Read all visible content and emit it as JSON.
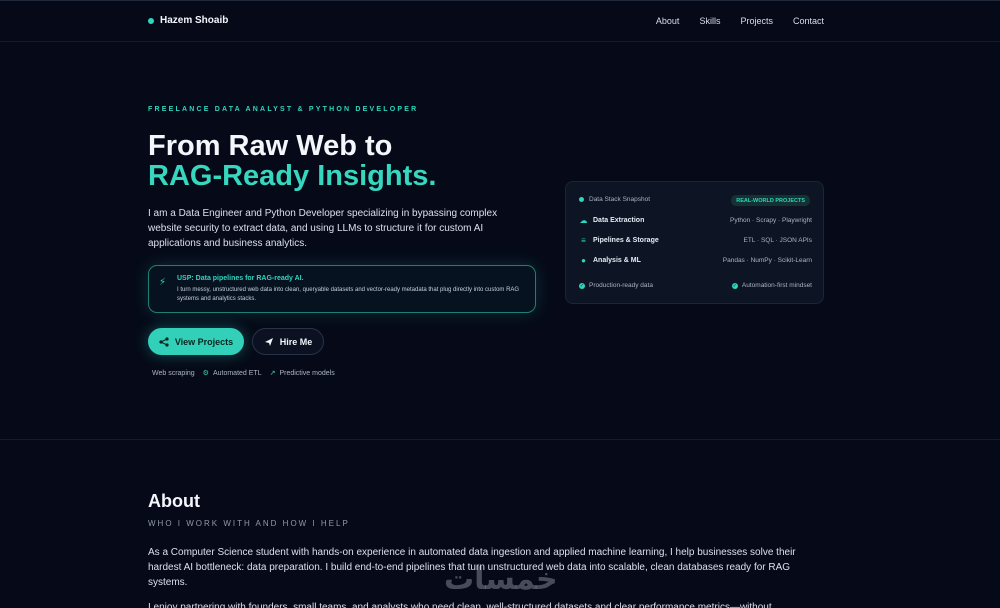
{
  "nav": {
    "brand": "Hazem Shoaib",
    "links": [
      "About",
      "Skills",
      "Projects",
      "Contact"
    ]
  },
  "hero": {
    "eyebrow": "FREELANCE DATA ANALYST & PYTHON DEVELOPER",
    "title_line1": "From Raw Web to",
    "title_line2": "RAG-Ready Insights.",
    "lead": "I am a Data Engineer and Python Developer specializing in bypassing complex website security to extract data, and using LLMs to structure it for custom AI applications and business analytics.",
    "usp_title": "USP: Data pipelines for RAG-ready AI.",
    "usp_text": "I turn messy, unstructured web data into clean, queryable datasets and vector-ready metadata that plug directly into custom RAG systems and analytics stacks.",
    "primary_button": "View Projects",
    "secondary_button": "Hire Me",
    "tags": [
      "Web scraping",
      "Automated ETL",
      "Predictive models"
    ]
  },
  "card": {
    "title": "Data Stack Snapshot",
    "badge": "REAL-WORLD PROJECTS",
    "rows": [
      {
        "label": "Data Extraction",
        "value": "Python · Scrapy · Playwright",
        "icon": "cloud-icon"
      },
      {
        "label": "Pipelines & Storage",
        "value": "ETL · SQL · JSON APIs",
        "icon": "database-icon"
      },
      {
        "label": "Analysis & ML",
        "value": "Pandas · NumPy · Scikit-Learn",
        "icon": "brain-icon"
      }
    ],
    "footer_left": "Production-ready data",
    "footer_right": "Automation-first mindset"
  },
  "about": {
    "title": "About",
    "subtitle": "WHO I WORK WITH AND HOW I HELP",
    "p1": "As a Computer Science student with hands-on experience in automated data ingestion and applied machine learning, I help businesses solve their hardest AI bottleneck: data preparation. I build end-to-end pipelines that turn unstructured web data into scalable, clean databases ready for RAG systems.",
    "p2": "I enjoy partnering with founders, small teams, and analysts who need clean, well-structured datasets and clear performance metrics—without"
  },
  "watermark": "خمسات",
  "colors": {
    "accent": "#2fd5bd",
    "background": "#060a18",
    "card": "#0d1424"
  }
}
